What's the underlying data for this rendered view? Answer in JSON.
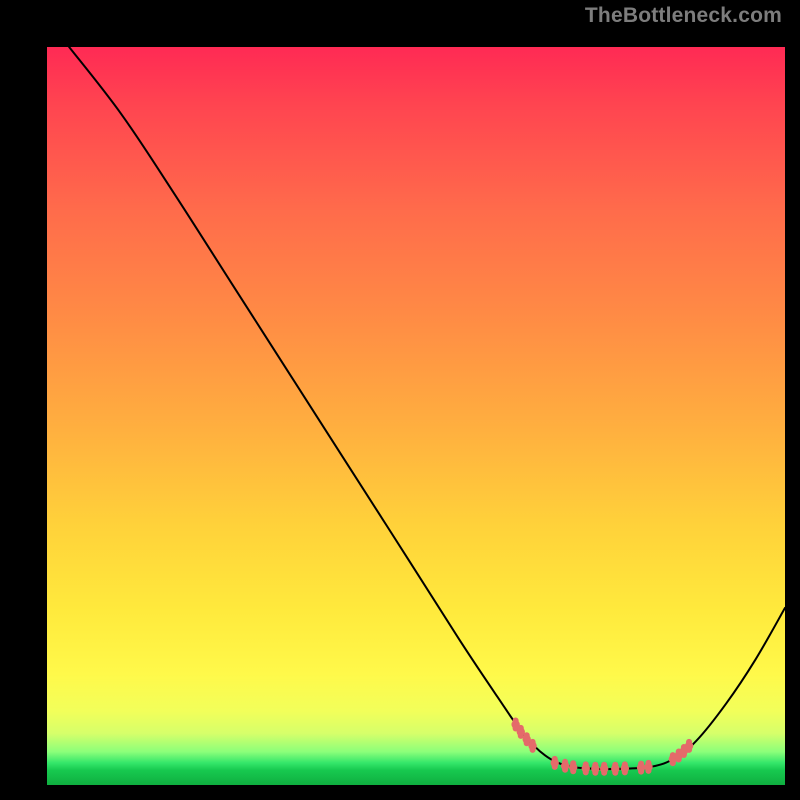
{
  "watermark": "TheBottleneck.com",
  "chart_data": {
    "type": "line",
    "title": "",
    "xlabel": "",
    "ylabel": "",
    "xlim": [
      0,
      100
    ],
    "ylim": [
      0,
      100
    ],
    "curve_note": "Black curve: descends from top-left, reaches a flat minimum around x≈70–85, then rises toward the right edge. Coral dots cluster along the flat minimum and on both shoulders of the valley.",
    "curve_points": [
      {
        "x": 3.0,
        "y": 100.0
      },
      {
        "x": 10.0,
        "y": 91.0
      },
      {
        "x": 17.0,
        "y": 80.5
      },
      {
        "x": 25.0,
        "y": 68.0
      },
      {
        "x": 33.0,
        "y": 55.5
      },
      {
        "x": 41.0,
        "y": 43.0
      },
      {
        "x": 49.0,
        "y": 30.5
      },
      {
        "x": 56.0,
        "y": 19.5
      },
      {
        "x": 61.0,
        "y": 12.0
      },
      {
        "x": 64.5,
        "y": 7.0
      },
      {
        "x": 67.5,
        "y": 4.0
      },
      {
        "x": 70.5,
        "y": 2.6
      },
      {
        "x": 74.0,
        "y": 2.2
      },
      {
        "x": 78.0,
        "y": 2.2
      },
      {
        "x": 82.0,
        "y": 2.5
      },
      {
        "x": 85.0,
        "y": 3.6
      },
      {
        "x": 88.0,
        "y": 6.0
      },
      {
        "x": 92.0,
        "y": 11.0
      },
      {
        "x": 96.0,
        "y": 17.0
      },
      {
        "x": 100.0,
        "y": 24.0
      }
    ],
    "marker_points": [
      {
        "x": 63.5,
        "y": 8.2
      },
      {
        "x": 64.2,
        "y": 7.2
      },
      {
        "x": 65.0,
        "y": 6.2
      },
      {
        "x": 65.8,
        "y": 5.3
      },
      {
        "x": 68.8,
        "y": 3.0
      },
      {
        "x": 70.2,
        "y": 2.6
      },
      {
        "x": 71.3,
        "y": 2.4
      },
      {
        "x": 73.0,
        "y": 2.25
      },
      {
        "x": 74.3,
        "y": 2.2
      },
      {
        "x": 75.5,
        "y": 2.2
      },
      {
        "x": 77.0,
        "y": 2.2
      },
      {
        "x": 78.3,
        "y": 2.25
      },
      {
        "x": 80.5,
        "y": 2.35
      },
      {
        "x": 81.5,
        "y": 2.45
      },
      {
        "x": 84.8,
        "y": 3.5
      },
      {
        "x": 85.6,
        "y": 4.0
      },
      {
        "x": 86.3,
        "y": 4.6
      },
      {
        "x": 87.0,
        "y": 5.3
      }
    ],
    "gradient_stops": [
      {
        "pos": 0.0,
        "color": "#ff2a54"
      },
      {
        "pos": 0.5,
        "color": "#ffb83d"
      },
      {
        "pos": 0.82,
        "color": "#fff948"
      },
      {
        "pos": 0.96,
        "color": "#46e766"
      },
      {
        "pos": 1.0,
        "color": "#0fae40"
      }
    ]
  }
}
